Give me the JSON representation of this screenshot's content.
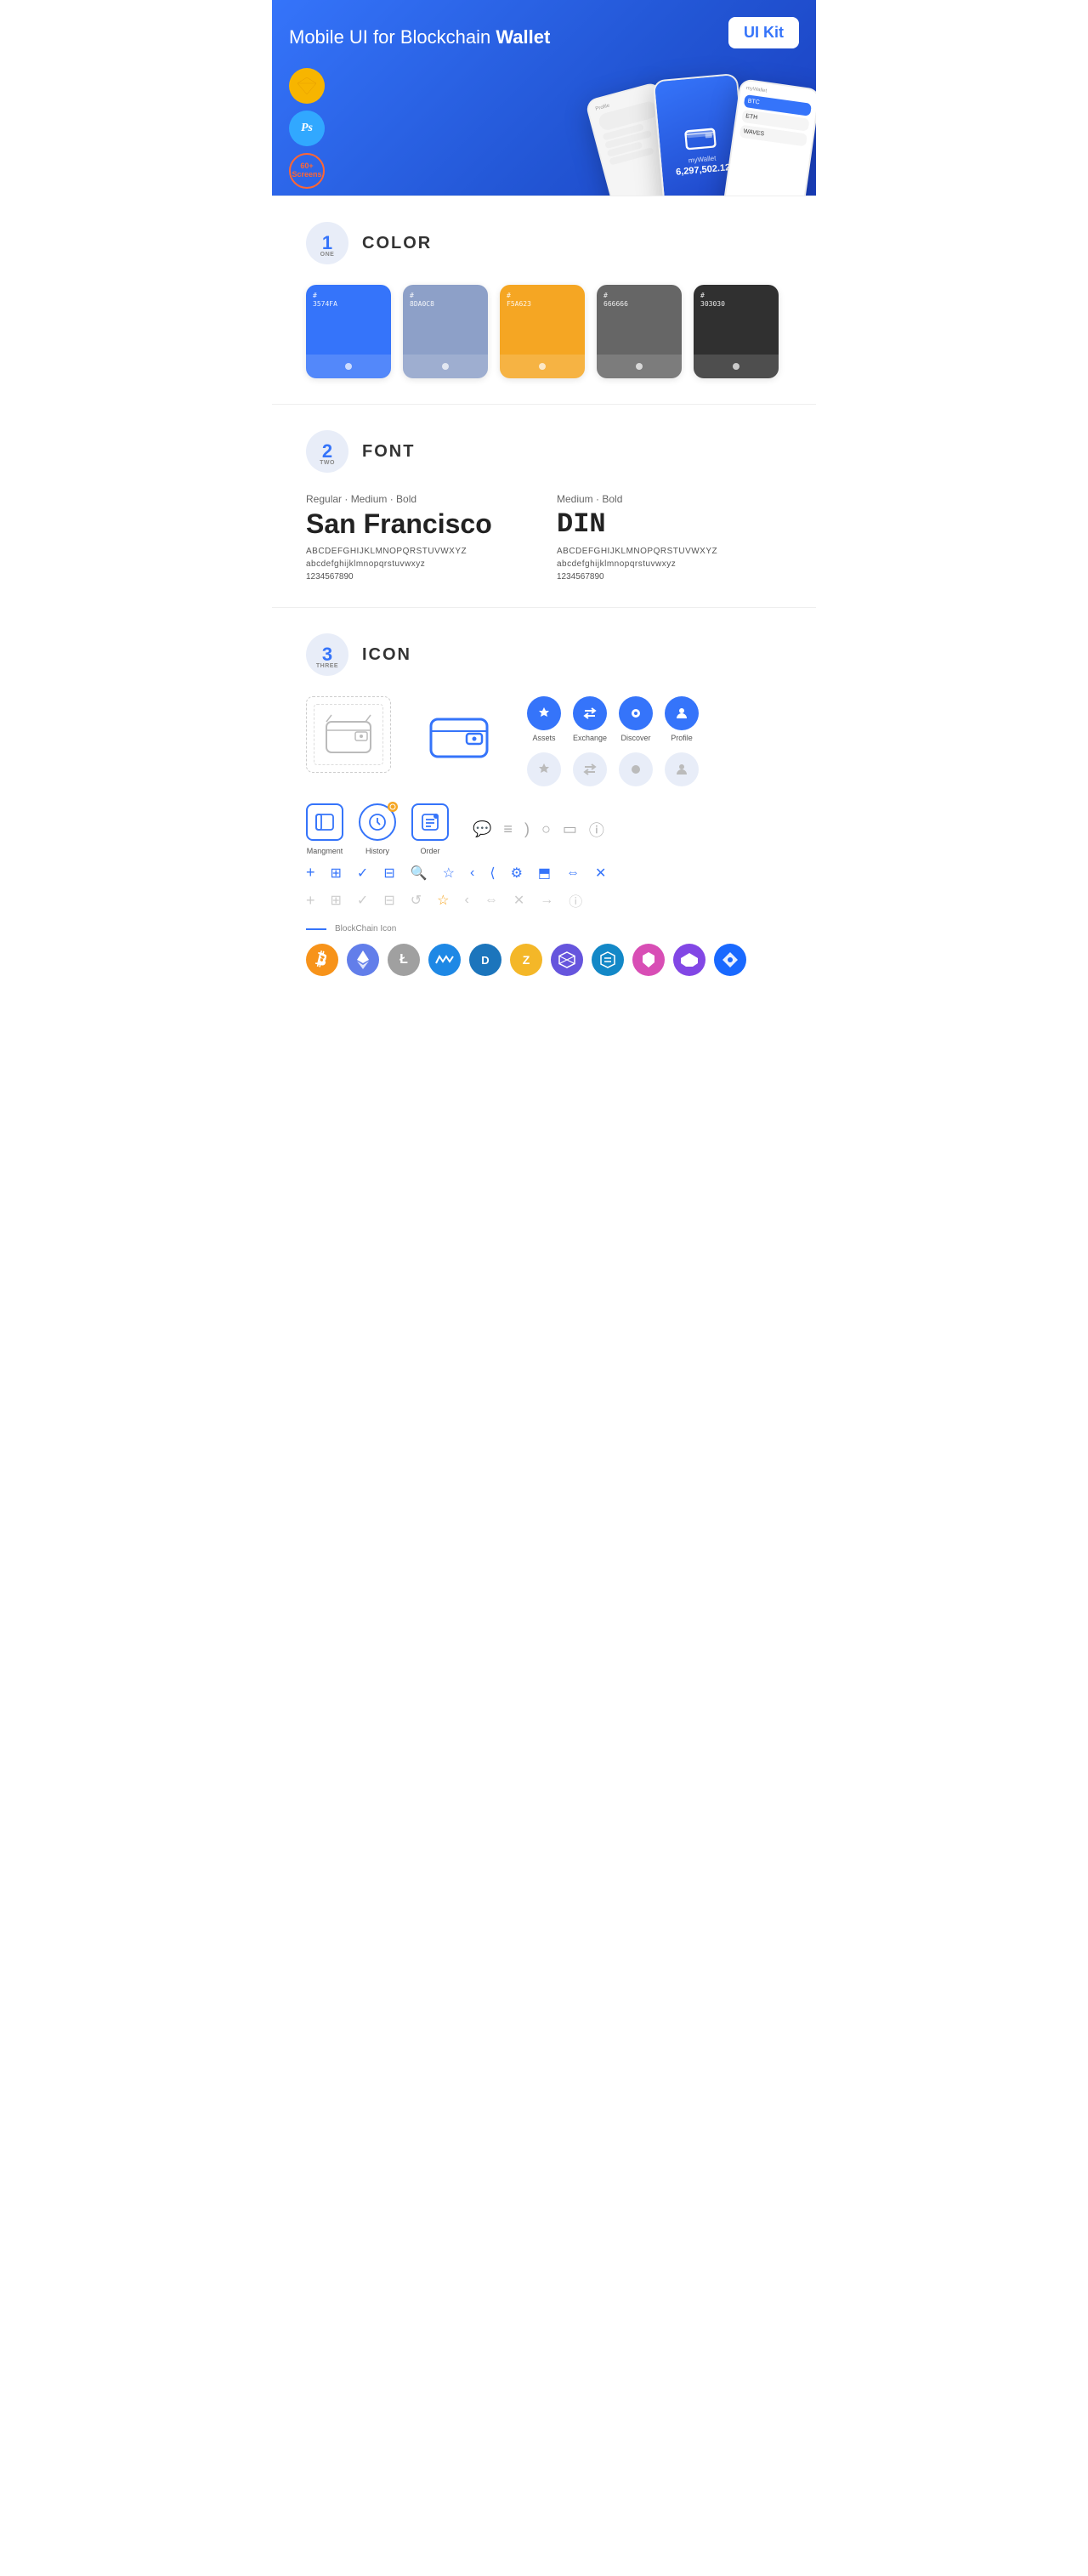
{
  "hero": {
    "title": "Mobile UI for Blockchain ",
    "title_bold": "Wallet",
    "badge": "UI Kit",
    "badge_sketch": "S",
    "badge_ps": "Ps",
    "badge_screens": "60+\nScreens"
  },
  "sections": {
    "color": {
      "number": "1",
      "label": "ONE",
      "title": "COLOR",
      "swatches": [
        {
          "hex": "#3574FA",
          "code": "#\n3574FA",
          "id": "blue"
        },
        {
          "hex": "#8DA0C8",
          "code": "#\n8DA0C8",
          "id": "slate"
        },
        {
          "hex": "#F5A623",
          "code": "#\nF5A623",
          "id": "orange"
        },
        {
          "hex": "#666666",
          "code": "#\n666666",
          "id": "gray"
        },
        {
          "hex": "#303030",
          "code": "#\n303030",
          "id": "dark"
        }
      ]
    },
    "font": {
      "number": "2",
      "label": "TWO",
      "title": "FONT",
      "fonts": [
        {
          "style_label": "Regular · Medium · Bold",
          "name": "San Francisco",
          "uppercase": "ABCDEFGHIJKLMNOPQRSTUVWXYZ",
          "lowercase": "abcdefghijklmnopqrstuvwxyz",
          "numbers": "1234567890"
        },
        {
          "style_label": "Medium · Bold",
          "name": "DIN",
          "uppercase": "ABCDEFGHIJKLMNOPQRSTUVWXYZ",
          "lowercase": "abcdefghijklmnopqrstuvwxyz",
          "numbers": "1234567890"
        }
      ]
    },
    "icon": {
      "number": "3",
      "label": "THREE",
      "title": "ICON",
      "nav_icons": [
        {
          "label": "Assets",
          "glyph": "◆",
          "active": true
        },
        {
          "label": "Exchange",
          "glyph": "⇄",
          "active": true
        },
        {
          "label": "Discover",
          "glyph": "●",
          "active": true
        },
        {
          "label": "Profile",
          "glyph": "⌀",
          "active": true
        }
      ],
      "nav_icons_ghost": [
        {
          "glyph": "◆"
        },
        {
          "glyph": "⇄"
        },
        {
          "glyph": "●"
        },
        {
          "glyph": "⌀"
        }
      ],
      "mid_icons": [
        {
          "label": "Mangment",
          "glyph": "▤"
        },
        {
          "label": "History",
          "glyph": "⏱"
        },
        {
          "label": "Order",
          "glyph": "≡"
        }
      ],
      "small_icons": [
        "+",
        "⊞",
        "✓",
        "⊟",
        "🔍",
        "☆",
        "‹",
        "⟨",
        "⚙",
        "⬒",
        "⇔",
        "✕"
      ],
      "small_icons_ghost": [
        "+",
        "⊞",
        "✓",
        "⊟",
        "↺",
        "☆",
        "‹",
        "⇔",
        "✕",
        "→",
        "ⓘ"
      ],
      "blockchain_label": "BlockChain Icon",
      "crypto_coins": [
        {
          "symbol": "₿",
          "id": "btc",
          "class": "crypto-btc"
        },
        {
          "symbol": "Ξ",
          "id": "eth",
          "class": "crypto-eth"
        },
        {
          "symbol": "Ł",
          "id": "ltc",
          "class": "crypto-ltc"
        },
        {
          "symbol": "W",
          "id": "waves",
          "class": "crypto-waves"
        },
        {
          "symbol": "D",
          "id": "dash",
          "class": "crypto-dash"
        },
        {
          "symbol": "Z",
          "id": "zcash",
          "class": "crypto-zcash"
        },
        {
          "symbol": "◈",
          "id": "grid",
          "class": "crypto-grid"
        },
        {
          "symbol": "S",
          "id": "stratis",
          "class": "crypto-stratis"
        },
        {
          "symbol": "A",
          "id": "ark",
          "class": "crypto-ark"
        },
        {
          "symbol": "M",
          "id": "matic",
          "class": "crypto-matic"
        },
        {
          "symbol": "F",
          "id": "ftm",
          "class": "crypto-ftm"
        }
      ]
    }
  }
}
